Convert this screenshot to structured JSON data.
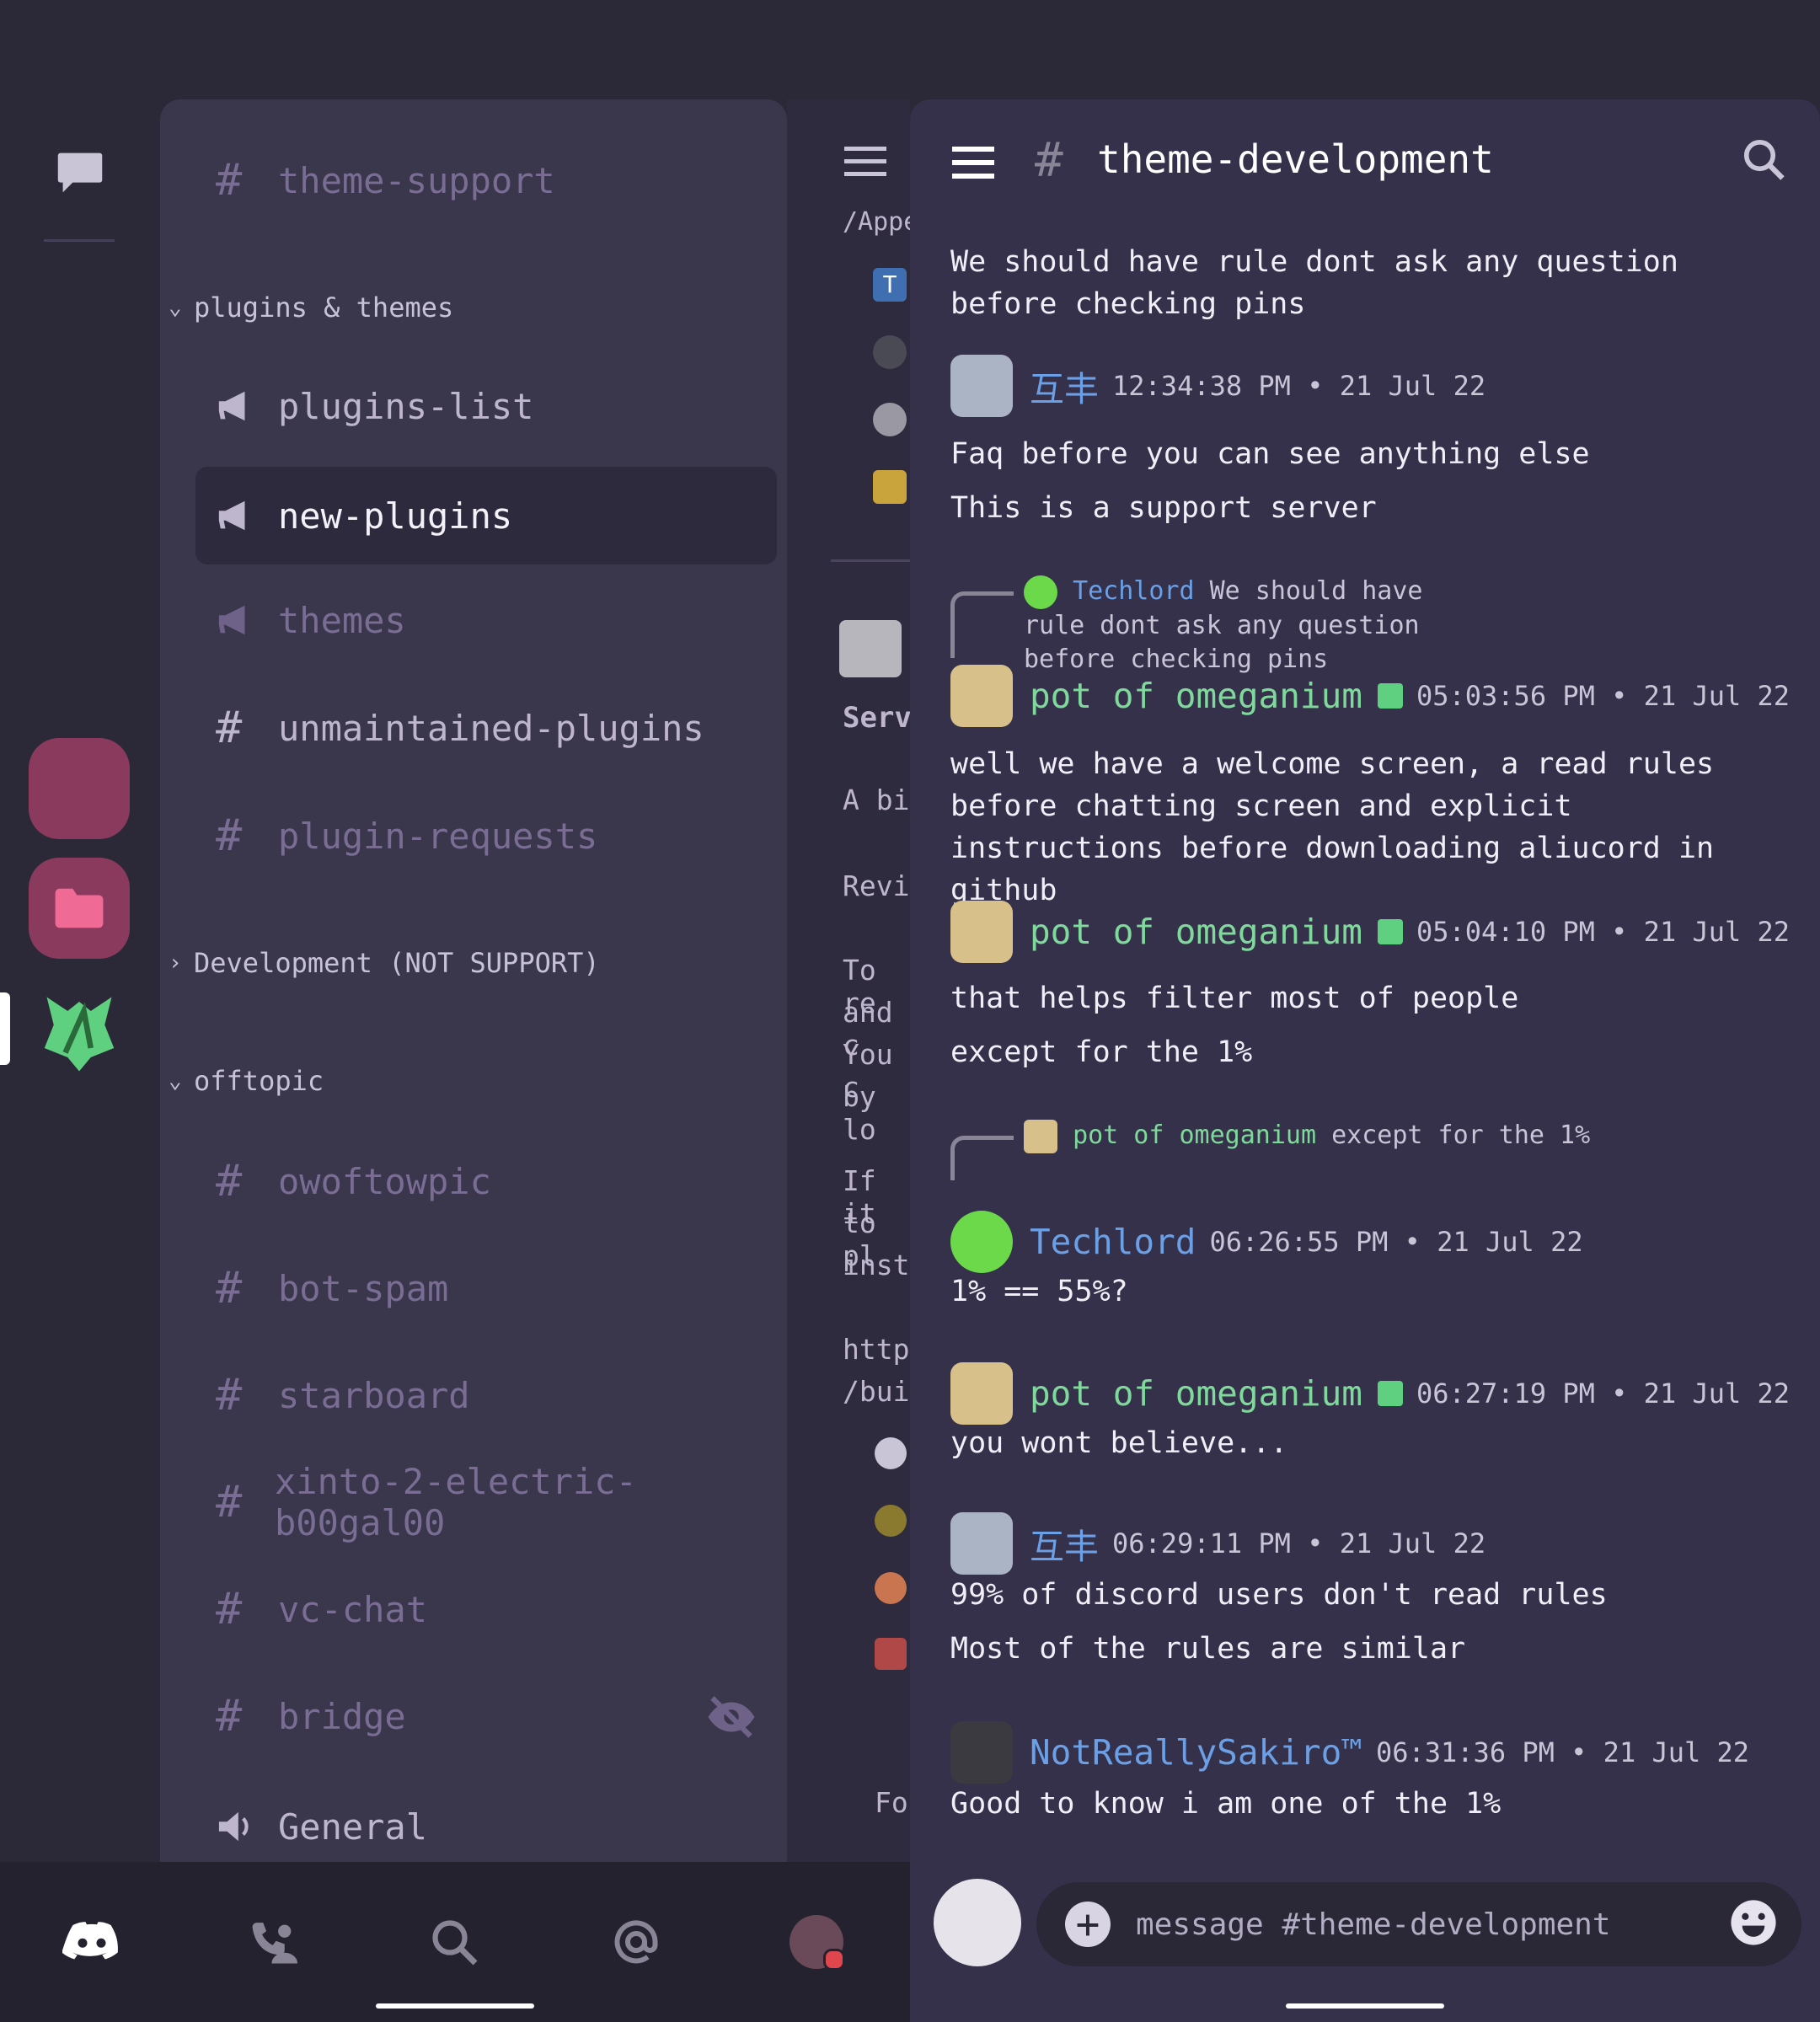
{
  "channels_panel": {
    "top_channel": "theme-support",
    "categories": [
      {
        "label": "plugins & themes",
        "channels": [
          "plugins-list",
          "new-plugins",
          "themes",
          "unmaintained-plugins",
          "plugin-requests"
        ]
      },
      {
        "label": "Development (NOT SUPPORT)"
      },
      {
        "label": "offtopic",
        "channels": [
          "owoftowpic",
          "bot-spam",
          "starboard",
          "xinto-2-electric-b00gal00",
          "vc-chat",
          "bridge",
          "General"
        ]
      }
    ]
  },
  "middle_strip": {
    "fragments": [
      "/Appe",
      "Serv",
      "A bi",
      "Revi",
      "To re",
      "and c",
      "You c",
      "by lo",
      "If it",
      "to pl",
      "instr",
      "https",
      "/buil",
      "Fo"
    ]
  },
  "chat": {
    "channel_name": "theme-development",
    "top_message": "We should have rule dont ask any question before checking pins",
    "messages": [
      {
        "author": "互丰",
        "time": "12:34:38 PM • 21 Jul 22",
        "lines": [
          "Faq before you can see anything else",
          "This is a support server"
        ]
      },
      {
        "reply_author": "Techlord",
        "reply_text": "We should have rule dont ask any question before checking pins",
        "author": "pot of omeganium",
        "time": "05:03:56 PM • 21 Jul 22",
        "lines": [
          "well we have a welcome screen, a read rules before chatting screen and explicit instructions before downloading aliucord in github"
        ]
      },
      {
        "author": "pot of omeganium",
        "time": "05:04:10 PM • 21 Jul 22",
        "lines": [
          "that helps filter most of people",
          "except for the 1%"
        ]
      },
      {
        "reply_author": "pot of omeganium",
        "reply_text": "except for the 1%",
        "author": "Techlord",
        "time": "06:26:55 PM • 21 Jul 22",
        "lines": [
          "1% == 55%?"
        ]
      },
      {
        "author": "pot of omeganium",
        "time": "06:27:19 PM • 21 Jul 22",
        "lines": [
          "you wont believe..."
        ]
      },
      {
        "author": "互丰",
        "time": "06:29:11 PM • 21 Jul 22",
        "lines": [
          "99% of discord users don't read rules",
          "Most of the rules are similar"
        ]
      },
      {
        "author": "NotReallySakiro™",
        "time": "06:31:36 PM • 21 Jul 22",
        "lines": [
          "Good to know i am one of the 1%"
        ]
      }
    ],
    "input_placeholder": "message #theme-development"
  },
  "colors": {
    "accent_green": "#7fd99b",
    "accent_blue": "#6b9fe6",
    "server_pink": "#8a3a5c",
    "background": "#2b2838"
  },
  "icons": [
    "chat-bubble-icon",
    "folder-icon",
    "hash-icon",
    "megaphone-icon",
    "speaker-icon",
    "eye-off-icon",
    "hamburger-icon",
    "search-icon",
    "plus-icon",
    "emoji-icon",
    "discord-icon",
    "friends-icon",
    "mention-icon"
  ]
}
